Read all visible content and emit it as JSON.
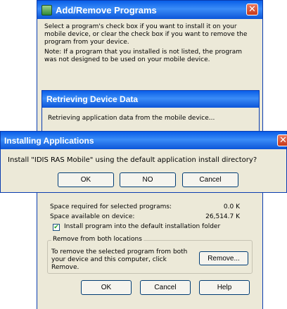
{
  "main_window": {
    "title": "Add/Remove Programs",
    "intro_text": "Select a program's check box if you want to install it on your mobile device, or clear the check box if you want to remove the program from your device.",
    "note_text": "Note:  If a program that you installed is not listed, the program was not designed to be used on your mobile device.",
    "space_required_label": "Space required for selected programs:",
    "space_required_value": "0.0 K",
    "space_available_label": "Space available on device:",
    "space_available_value": "26,514.7 K",
    "install_default_checked": true,
    "install_default_label": "Install program into the default installation folder",
    "group_title": "Remove from both locations",
    "group_text": "To remove the selected program from both your device and this computer, click Remove.",
    "remove_label": "Remove...",
    "ok_label": "OK",
    "cancel_label": "Cancel",
    "help_label": "Help"
  },
  "retrieving_dialog": {
    "title": "Retrieving Device Data",
    "message": "Retrieving application data from the mobile device..."
  },
  "install_dialog": {
    "title": "Installing Applications",
    "message": "Install \"IDIS RAS Mobile\" using the default application install directory?",
    "ok_label": "OK",
    "no_label": "NO",
    "cancel_label": "Cancel"
  },
  "colors": {
    "title_blue": "#0a5ee8",
    "close_red": "#c9391a",
    "window_face": "#ece9d8"
  }
}
